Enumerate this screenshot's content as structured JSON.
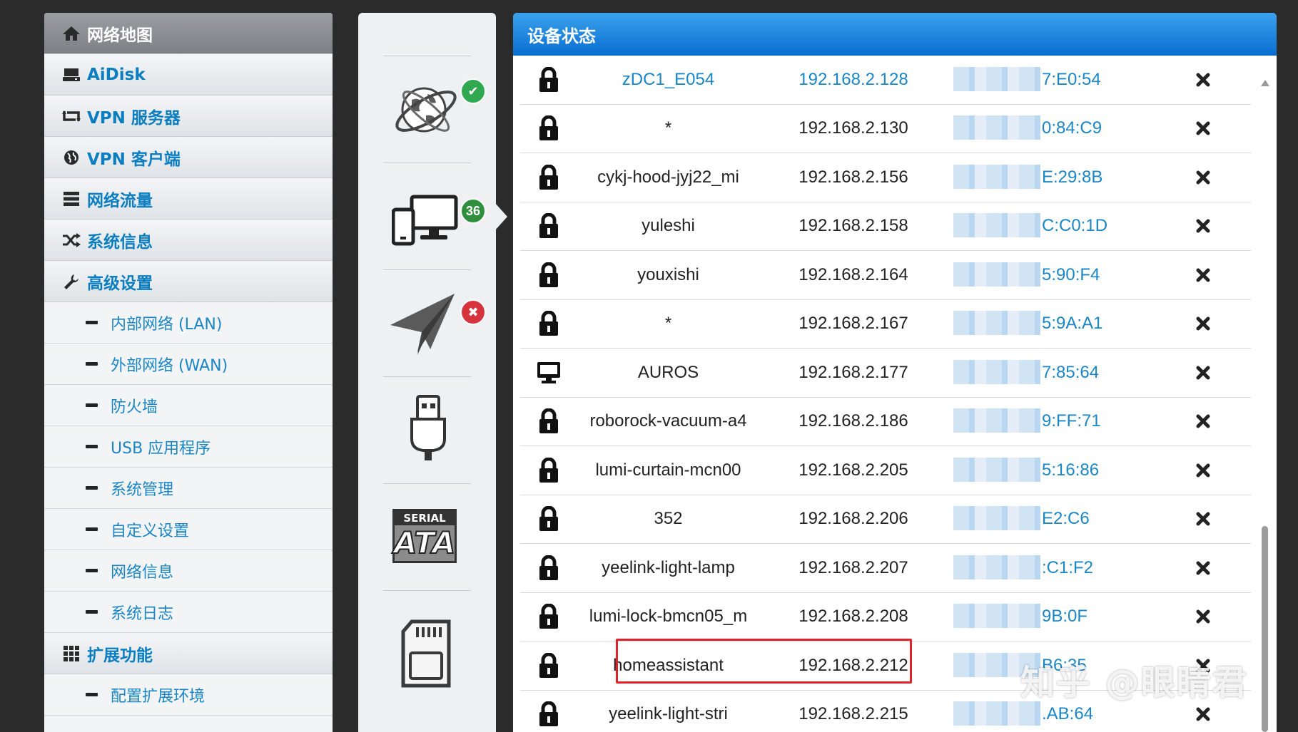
{
  "sidebar": {
    "items": [
      {
        "label": "网络地图",
        "icon": "home-icon"
      },
      {
        "label": "AiDisk",
        "icon": "disk-icon"
      },
      {
        "label": "VPN 服务器",
        "icon": "vpn-server-icon"
      },
      {
        "label": "VPN 客户端",
        "icon": "globe-icon"
      },
      {
        "label": "网络流量",
        "icon": "traffic-icon"
      },
      {
        "label": "系统信息",
        "icon": "shuffle-icon"
      },
      {
        "label": "高级设置",
        "icon": "wrench-icon"
      }
    ],
    "sub_items": [
      {
        "label": "内部网络 (LAN)"
      },
      {
        "label": "外部网络 (WAN)"
      },
      {
        "label": "防火墙"
      },
      {
        "label": "USB 应用程序"
      },
      {
        "label": "系统管理"
      },
      {
        "label": "自定义设置"
      },
      {
        "label": "网络信息"
      },
      {
        "label": "系统日志"
      }
    ],
    "extension": {
      "label": "扩展功能",
      "icon": "grid-icon"
    },
    "extension_sub": {
      "label": "配置扩展环境"
    }
  },
  "status_icons": {
    "internet": {
      "icon": "internet-globe-icon",
      "badge": "ok"
    },
    "clients": {
      "icon": "devices-icon",
      "count": "36"
    },
    "vpn": {
      "icon": "paper-plane-icon",
      "badge": "error"
    },
    "usb": {
      "icon": "usb-icon"
    },
    "sata": {
      "icon": "sata-icon",
      "line1": "SERIAL",
      "line2": "ATA"
    },
    "sdcard": {
      "icon": "sd-card-icon"
    }
  },
  "panel": {
    "title": "设备状态",
    "rows": [
      {
        "type": "lock",
        "name": "zDC1_E054",
        "ip": "192.168.2.128",
        "mac": "7:E0:54",
        "link": true
      },
      {
        "type": "lock",
        "name": "*",
        "ip": "192.168.2.130",
        "mac": "0:84:C9",
        "link": false
      },
      {
        "type": "lock",
        "name": "cykj-hood-jyj22_mi",
        "ip": "192.168.2.156",
        "mac": "E:29:8B",
        "link": false
      },
      {
        "type": "lock",
        "name": "yuleshi",
        "ip": "192.168.2.158",
        "mac": "C:C0:1D",
        "link": false
      },
      {
        "type": "lock",
        "name": "youxishi",
        "ip": "192.168.2.164",
        "mac": "5:90:F4",
        "link": false
      },
      {
        "type": "lock",
        "name": "*",
        "ip": "192.168.2.167",
        "mac": "5:9A:A1",
        "link": false
      },
      {
        "type": "pc",
        "name": "AUROS",
        "ip": "192.168.2.177",
        "mac": "7:85:64",
        "link": false
      },
      {
        "type": "lock",
        "name": "roborock-vacuum-a4",
        "ip": "192.168.2.186",
        "mac": "9:FF:71",
        "link": false
      },
      {
        "type": "lock",
        "name": "lumi-curtain-mcn00",
        "ip": "192.168.2.205",
        "mac": "5:16:86",
        "link": false
      },
      {
        "type": "lock",
        "name": "352",
        "ip": "192.168.2.206",
        "mac": "E2:C6",
        "link": false
      },
      {
        "type": "lock",
        "name": "yeelink-light-lamp",
        "ip": "192.168.2.207",
        "mac": ":C1:F2",
        "link": false
      },
      {
        "type": "lock",
        "name": "lumi-lock-bmcn05_m",
        "ip": "192.168.2.208",
        "mac": "9B:0F",
        "link": false
      },
      {
        "type": "lock",
        "name": "homeassistant",
        "ip": "192.168.2.212",
        "mac": "B6:35",
        "link": false
      },
      {
        "type": "lock",
        "name": "yeelink-light-stri",
        "ip": "192.168.2.215",
        "mac": ".AB:64",
        "link": false
      }
    ]
  },
  "watermark": "知乎 @眼睛君",
  "colors": {
    "accent": "#0b7ec0",
    "header_blue": "#0a6ed1",
    "highlight_red": "#e0222a",
    "ok_green": "#2fa84f",
    "error_red": "#d7333d"
  }
}
